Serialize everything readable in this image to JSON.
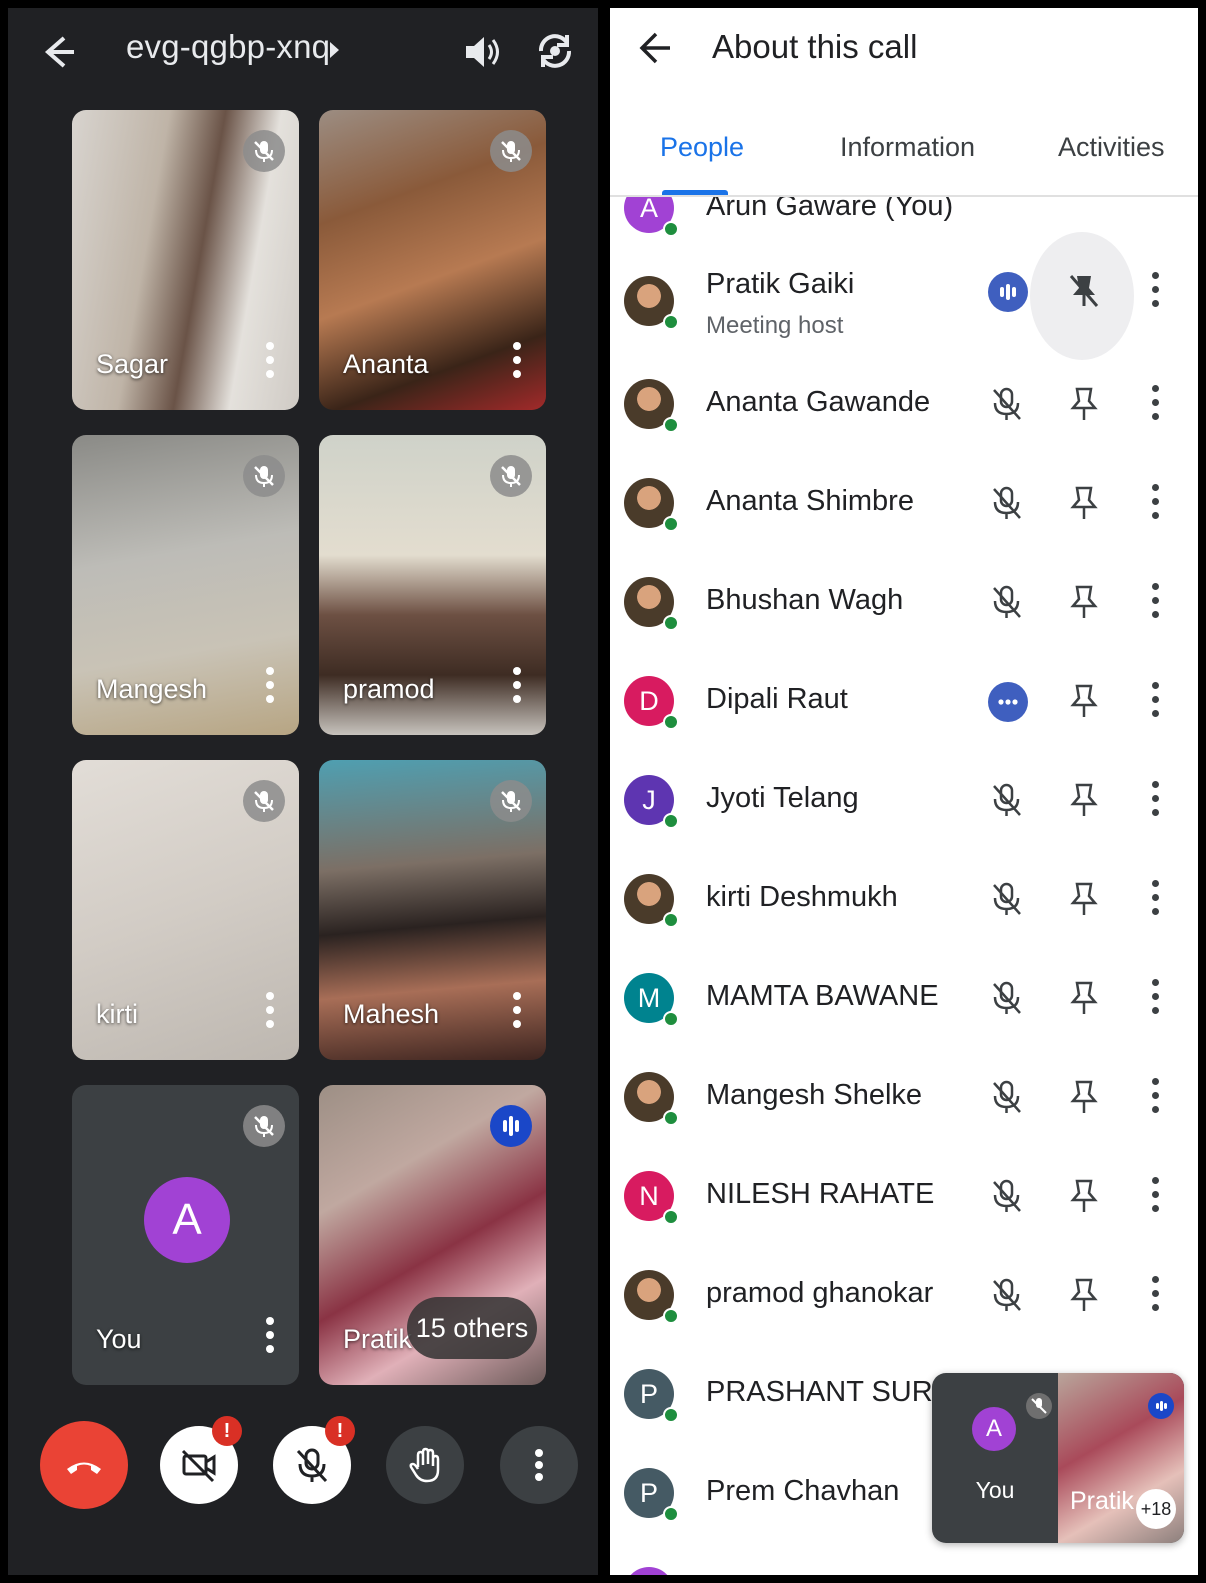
{
  "left": {
    "meeting_code": "evg-qgbp-xnq",
    "tiles": [
      {
        "name": "Sagar",
        "state": "muted"
      },
      {
        "name": "Ananta",
        "state": "muted"
      },
      {
        "name": "Mangesh",
        "state": "muted"
      },
      {
        "name": "pramod",
        "state": "muted"
      },
      {
        "name": "kirti",
        "state": "muted"
      },
      {
        "name": "Mahesh",
        "state": "muted"
      },
      {
        "name": "You",
        "avatar_letter": "A",
        "state": "muted"
      },
      {
        "name": "Pratik",
        "others_label": "15 others",
        "state": "speaking"
      }
    ],
    "controls": {
      "end_call": "phone-hangup-icon",
      "camera_alert": "!",
      "mic_alert": "!"
    }
  },
  "right": {
    "title": "About this call",
    "tabs": [
      "People",
      "Information",
      "Activities"
    ],
    "active_tab": "People",
    "people": [
      {
        "name": "Arun Gaware (You)",
        "letter": "A",
        "color": "#a142d4",
        "partial": true
      },
      {
        "name": "Pratik Gaiki",
        "subtitle": "Meeting host",
        "avatar": "photo",
        "state": "speaking",
        "pinned_off": true
      },
      {
        "name": "Ananta Gawande",
        "avatar": "photo",
        "state": "muted"
      },
      {
        "name": "Ananta Shimbre",
        "avatar": "photo",
        "state": "muted"
      },
      {
        "name": "Bhushan Wagh",
        "avatar": "photo",
        "state": "muted"
      },
      {
        "name": "Dipali Raut",
        "letter": "D",
        "color": "#d81b60",
        "state": "connecting"
      },
      {
        "name": "Jyoti Telang",
        "letter": "J",
        "color": "#5e35b1",
        "state": "muted"
      },
      {
        "name": "kirti Deshmukh",
        "avatar": "photo",
        "state": "muted"
      },
      {
        "name": "MAMTA BAWANE",
        "letter": "M",
        "color": "#00838f",
        "state": "muted"
      },
      {
        "name": "Mangesh Shelke",
        "avatar": "photo",
        "state": "muted"
      },
      {
        "name": "NILESH RAHATE",
        "letter": "N",
        "color": "#d81b60",
        "state": "muted"
      },
      {
        "name": "pramod ghanokar",
        "avatar": "photo",
        "state": "muted"
      },
      {
        "name": "PRASHANT SURAL...",
        "letter": "P",
        "color": "#455a64",
        "state": "muted"
      },
      {
        "name": "Prem Chavhan",
        "letter": "P",
        "color": "#455a64",
        "state": "muted"
      }
    ],
    "mini_player": {
      "you_letter": "A",
      "you_label": "You",
      "other_label": "Pratik",
      "other_count": "+18"
    }
  }
}
